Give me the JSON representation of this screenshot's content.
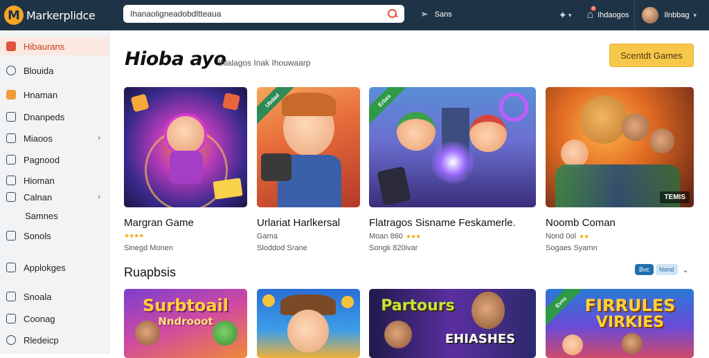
{
  "brand": {
    "logo_letter": "M",
    "name": "Markerplidce"
  },
  "search": {
    "value": "Ihanaoligneadobdltteaua"
  },
  "nav": {
    "share_label": "Sans"
  },
  "header_right": {
    "badge": "8",
    "messages_label": "Ihdaogos",
    "user_label": "Ilnbbag"
  },
  "sidebar": {
    "items": [
      {
        "label": "Hibaurans",
        "state": "active"
      },
      {
        "label": "Blouida"
      },
      {
        "label": "Hnaman",
        "state": "orange"
      },
      {
        "label": "Dnanpeds"
      },
      {
        "label": "Miaoos",
        "chevron": true
      },
      {
        "label": "Pagnood"
      },
      {
        "label": "Hioman"
      },
      {
        "label": "Calnan",
        "chevron": true
      },
      {
        "label": "Samnes"
      },
      {
        "label": "Sonols"
      },
      {
        "label": "Applokges"
      },
      {
        "label": "Snoala"
      },
      {
        "label": "Coonag"
      },
      {
        "label": "Rledeicp"
      }
    ],
    "chevron_glyph": "›"
  },
  "main": {
    "title": "Hioba ayo",
    "subtitle": "Ihlalagos Inak Ihouwaarp",
    "cta_label": "Scentdt Games"
  },
  "featured": [
    {
      "title": "Margran Game",
      "stars": "★★★★",
      "price": "Sinegd Monen"
    },
    {
      "title": "Urlariat Harlkersal",
      "stars": "",
      "meta": "Gama",
      "price": "Sloddod Srane",
      "ribbon": "Ubdad"
    },
    {
      "title": "Flatragos Sisname Feskamerle.",
      "meta": "Moan 860",
      "stars": "★★★",
      "price": "Songk 820ivar",
      "ribbon": "Erbas"
    },
    {
      "title": "Noomb Coman",
      "meta": "Nond 0ol",
      "stars": "★★",
      "price": "Sogaes Syamn",
      "tag": "TEMIS"
    }
  ],
  "section2": {
    "title": "Ruapbsis",
    "toggle_a": "Bvc",
    "toggle_b": "Nond",
    "chevron": "⌄"
  },
  "second_row": [
    {
      "art_text_1": "Surbtoail",
      "art_text_2": "Nndrooot"
    },
    {
      "art_text_1": ""
    },
    {
      "art_text_1": "Partours",
      "art_text_2": "EHIASHES"
    },
    {
      "art_text_1": "FIRRULES",
      "art_text_2": "VIRKIES",
      "ribbon": "Evns"
    }
  ],
  "colors": {
    "topbar": "#1f3346",
    "accent": "#e0533d",
    "cta": "#f7c74a",
    "toggle": "#1f6fb0"
  }
}
